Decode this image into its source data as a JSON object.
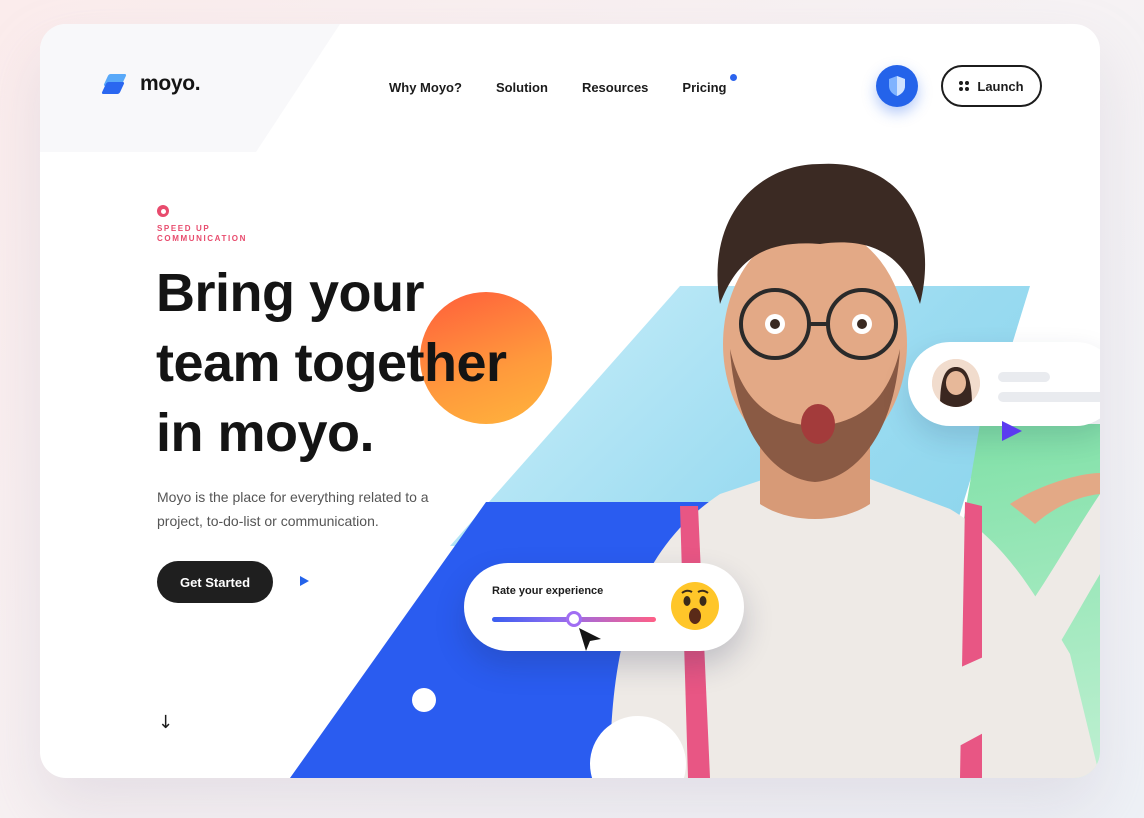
{
  "brand": {
    "name": "moyo.",
    "primary_color": "#2463ea",
    "accent_color": "#e84b6d"
  },
  "nav": {
    "items": [
      "Why Moyo?",
      "Solution",
      "Resources",
      "Pricing"
    ],
    "pricing_dot_color": "#2c64ee",
    "launch_label": "Launch",
    "shield_icon": "shield-icon"
  },
  "hero": {
    "eyebrow": "SPEED UP COMMUNICATION",
    "headline_line1": "Bring your",
    "headline_line2": "team together",
    "headline_line3": "in moyo.",
    "description": "Moyo is the place for everything related to a project, to-do-list or communication.",
    "cta_label": "Get Started",
    "scroll_icon": "arrow-down-icon"
  },
  "rating": {
    "label": "Rate your experience",
    "level": 0.5,
    "emoji": "surprised-face"
  }
}
